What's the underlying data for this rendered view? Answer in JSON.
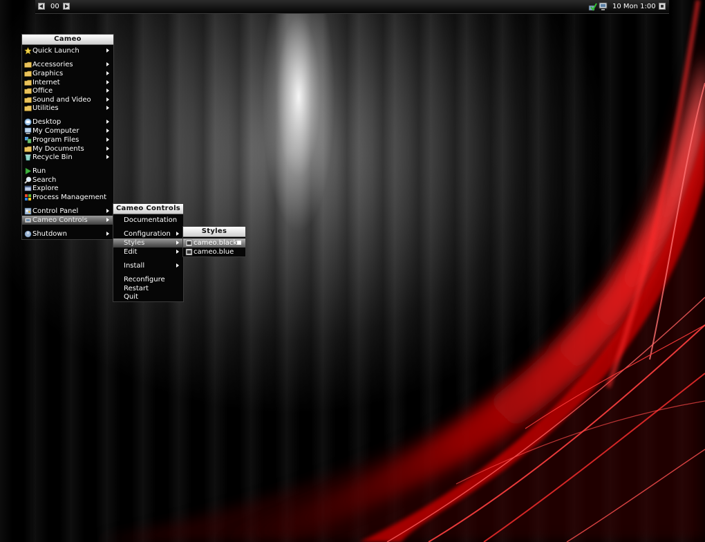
{
  "taskbar": {
    "workspace": "00",
    "clock": "10 Mon 1:00",
    "icons": [
      "prev-arrow-icon",
      "next-arrow-icon",
      "network-check-icon",
      "monitor-icon",
      "close-icon"
    ]
  },
  "main_menu": {
    "title": "Cameo",
    "items": [
      {
        "label": "Quick Launch",
        "icon": "star-icon"
      },
      {
        "label": "Accessories",
        "icon": "folder-icon"
      },
      {
        "label": "Graphics",
        "icon": "folder-icon"
      },
      {
        "label": "Internet",
        "icon": "folder-icon"
      },
      {
        "label": "Office",
        "icon": "folder-icon"
      },
      {
        "label": "Sound and Video",
        "icon": "folder-icon"
      },
      {
        "label": "Utilities",
        "icon": "folder-icon"
      },
      {
        "label": "Desktop",
        "icon": "desktop-icon"
      },
      {
        "label": "My Computer",
        "icon": "computer-icon"
      },
      {
        "label": "Program Files",
        "icon": "program-files-icon"
      },
      {
        "label": "My Documents",
        "icon": "folder-icon"
      },
      {
        "label": "Recycle Bin",
        "icon": "recycle-bin-icon"
      },
      {
        "label": "Run",
        "icon": "play-icon"
      },
      {
        "label": "Search",
        "icon": "magnifier-icon"
      },
      {
        "label": "Explore",
        "icon": "explore-icon"
      },
      {
        "label": "Process Management",
        "icon": "windows-icon"
      },
      {
        "label": "Control Panel",
        "icon": "control-panel-icon"
      },
      {
        "label": "Cameo Controls",
        "icon": "cameo-icon"
      },
      {
        "label": "Shutdown",
        "icon": "power-icon"
      }
    ]
  },
  "controls_menu": {
    "title": "Cameo Controls",
    "items": [
      {
        "label": "Documentation"
      },
      {
        "label": "Configuration"
      },
      {
        "label": "Styles"
      },
      {
        "label": "Edit"
      },
      {
        "label": "Install"
      },
      {
        "label": "Reconfigure"
      },
      {
        "label": "Restart"
      },
      {
        "label": "Quit"
      }
    ]
  },
  "styles_menu": {
    "title": "Styles",
    "items": [
      {
        "label": "cameo.black",
        "icon": "style-file-icon",
        "checked": true
      },
      {
        "label": "cameo.blue",
        "icon": "style-file-icon",
        "checked": false
      }
    ]
  },
  "colors": {
    "menu_bg": "#060606",
    "title_bg": "#ffffff",
    "selected": "#8a8a8a",
    "wallpaper_red": "#ff1a1a"
  }
}
